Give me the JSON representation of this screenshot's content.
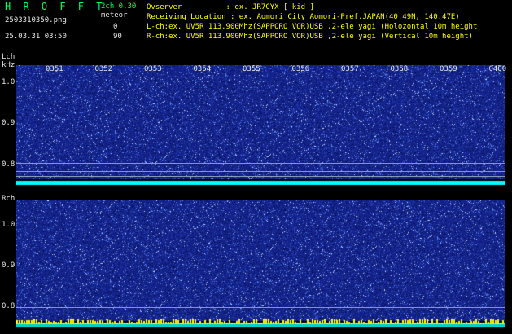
{
  "app": {
    "title": "H R O F F T",
    "version": "2ch 0.30",
    "filename": "2503310350.png",
    "datetime": "25.03.31 03:50",
    "meteor_label": "meteor",
    "ch_counts": [
      "0",
      "90"
    ]
  },
  "info": {
    "observer": "Ovserver          : ex. JR7CYX [ kid ]",
    "location": "Receiving Location : ex. Aomori City Aomori-Pref.JAPAN(40.49N, 140.47E)",
    "lch": "L-ch:ex. UV5R 113.900Mhz(SAPPORO VOR)USB ,2-ele yagi (Holozontal 10m height",
    "rch": "R-ch:ex. UV5R 113.900Mhz(SAPPORO VOR)USB ,2-ele yagi (Vertical 10m height)"
  },
  "axis": {
    "lch_label": "Lch",
    "unit": "kHz",
    "rch_label": "Rch",
    "time_ticks": [
      "0351",
      "0352",
      "0353",
      "0354",
      "0355",
      "0356",
      "0357",
      "0358",
      "0359",
      "0400"
    ],
    "lch_freq_ticks": [
      "1.0",
      "0.9",
      "0.8"
    ],
    "rch_freq_ticks": [
      "1.0",
      "0.9",
      "0.8"
    ]
  },
  "colors": {
    "title_green": "#00ff55",
    "background_blue": "#1a2b9a",
    "baseline_cyan": "#00ffff",
    "rch_baseline_yellow": "#ffff00"
  }
}
